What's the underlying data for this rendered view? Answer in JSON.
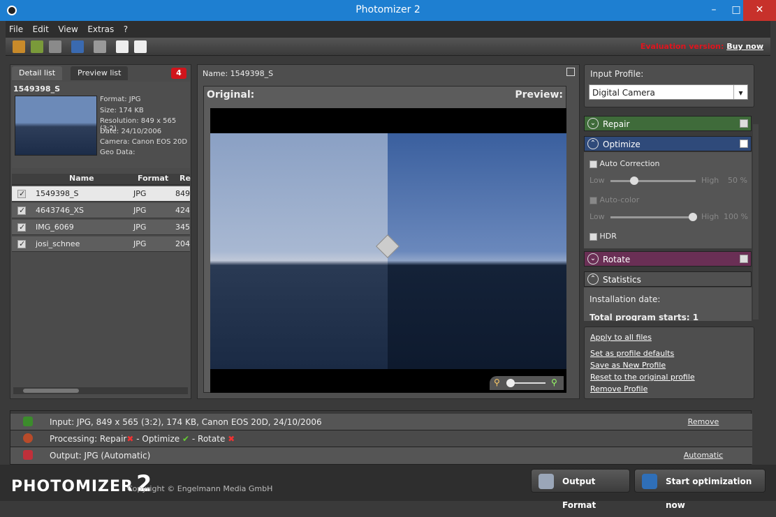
{
  "window": {
    "title": "Photomizer 2"
  },
  "menu": [
    "File",
    "Edit",
    "View",
    "Extras",
    "?"
  ],
  "evaluation": {
    "text": "Evaluation version:",
    "buy": "Buy now"
  },
  "left": {
    "tabs": [
      "Detail list",
      "Preview list"
    ],
    "badge": "4",
    "detail": {
      "name": "1549398_S",
      "format": "Format: JPG",
      "size": "Size: 174 KB",
      "resolution": "Resolution: 849 x 565 (3:2)",
      "date": "Date: 24/10/2006",
      "camera": "Camera: Canon EOS 20D",
      "geo": "Geo Data:"
    },
    "columns": [
      "Name",
      "Format",
      "Re"
    ],
    "rows": [
      {
        "name": "1549398_S",
        "format": "JPG",
        "res": "849"
      },
      {
        "name": "4643746_XS",
        "format": "JPG",
        "res": "424"
      },
      {
        "name": "IMG_6069",
        "format": "JPG",
        "res": "345"
      },
      {
        "name": "josi_schnee",
        "format": "JPG",
        "res": "204"
      }
    ]
  },
  "center": {
    "name": "Name: 1549398_S",
    "original": "Original:",
    "preview": "Preview:"
  },
  "right": {
    "input_profile_label": "Input Profile:",
    "input_profile_value": "Digital Camera",
    "repair": "Repair",
    "optimize": "Optimize",
    "auto_correction": "Auto Correction",
    "low": "Low",
    "high": "High",
    "val1": "50 %",
    "auto_color": "Auto-color",
    "val2": "100 %",
    "hdr": "HDR",
    "rotate": "Rotate",
    "statistics": "Statistics",
    "install_date": "Installation date:",
    "program_starts": "Total program starts: 1",
    "links": [
      "Apply to all files",
      "Set as profile defaults",
      "Save as New Profile",
      "Reset to the original profile",
      "Remove Profile"
    ]
  },
  "status": {
    "input": "Input: JPG, 849 x 565 (3:2), 174 KB, Canon EOS 20D, 24/10/2006",
    "input_action": "Remove",
    "processing_a": "Processing: Repair",
    "processing_b": " - Optimize ",
    "processing_c": " - Rotate ",
    "output": "Output: JPG (Automatic)",
    "output_action": "Automatic"
  },
  "footer": {
    "logo": "PHOTOMIZER",
    "logo_num": "2",
    "copyright": "Copyright © Engelmann Media GmbH",
    "output_format": "Output Format",
    "start": "Start optimization now"
  }
}
